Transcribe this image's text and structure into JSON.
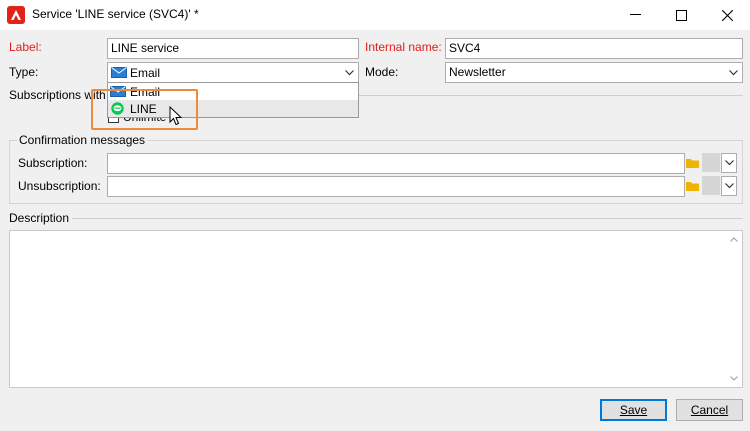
{
  "window": {
    "title": "Service 'LINE service (SVC4)' *",
    "accent_color": "#e0241b"
  },
  "form": {
    "label_caption": "Label:",
    "label_value": "LINE service",
    "internal_name_caption": "Internal name:",
    "internal_name_value": "SVC4",
    "type_caption": "Type:",
    "type_value": "Email",
    "mode_caption": "Mode:",
    "mode_value": "Newsletter",
    "subscriptions_caption": "Subscriptions with",
    "checkbox_label": "Unlimite"
  },
  "type_dropdown": {
    "options": [
      {
        "label": "Email",
        "icon": "envelope-icon"
      },
      {
        "label": "LINE",
        "icon": "line-icon",
        "hovered": true
      }
    ]
  },
  "confirmation": {
    "title": "Confirmation messages",
    "subscription_caption": "Subscription:",
    "unsubscription_caption": "Unsubscription:"
  },
  "description": {
    "title": "Description"
  },
  "buttons": {
    "save": "Save",
    "cancel": "Cancel"
  }
}
